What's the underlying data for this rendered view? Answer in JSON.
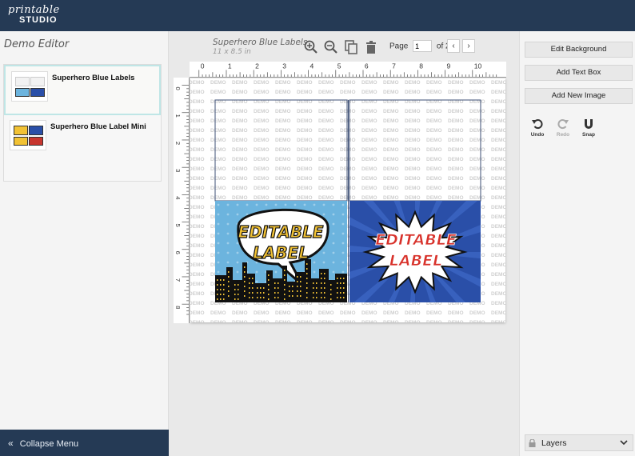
{
  "app": {
    "logo_script": "printable",
    "logo_bold": "STUDIO"
  },
  "sidebar": {
    "title": "Demo Editor",
    "projects": [
      {
        "name": "Superhero Blue Labels",
        "active": true
      },
      {
        "name": "Superhero Blue Label Mini",
        "active": false
      }
    ],
    "collapse_label": "Collapse Menu"
  },
  "document": {
    "title": "Superhero Blue Labels",
    "size": "11 x 8.5 in",
    "page_label": "Page",
    "page_current": "1",
    "page_total": "of 2"
  },
  "ruler": {
    "top_labels": [
      "0",
      "1",
      "2",
      "3",
      "4",
      "5",
      "6",
      "7",
      "8",
      "9",
      "10"
    ],
    "left_labels": [
      "0",
      "1",
      "2",
      "3",
      "4",
      "5",
      "6",
      "7",
      "8"
    ]
  },
  "canvas": {
    "watermark": "DEMO",
    "label_left": {
      "line1": "EDITABLE",
      "line2": "LABEL"
    },
    "label_right": {
      "line1": "EDITABLE",
      "line2": "LABEL"
    }
  },
  "rightpanel": {
    "edit_background": "Edit Background",
    "add_text_box": "Add Text Box",
    "add_new_image": "Add New Image",
    "undo": "Undo",
    "redo": "Redo",
    "snap": "Snap",
    "layers": "Layers"
  },
  "colors": {
    "header": "#253a55",
    "sky_blue": "#6cb4de",
    "royal_blue": "#2a4fa8",
    "comic_yellow": "#f2c234",
    "comic_red": "#d8322b"
  }
}
